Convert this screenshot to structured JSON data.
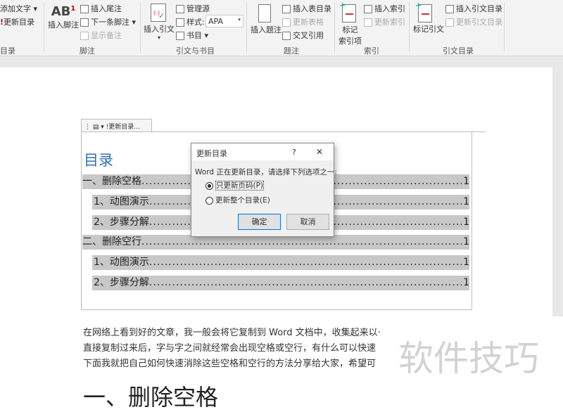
{
  "ribbon": {
    "toc_group": {
      "add_text": "添加文字 ▾",
      "update_toc": "更新目录",
      "label": "目录"
    },
    "footnotes": {
      "insert_footnote": "插入脚注",
      "insert_endnote": "插入尾注",
      "next_footnote": "下一条脚注 ▾",
      "show_notes": "显示备注",
      "label": "脚注"
    },
    "citations": {
      "insert_citation": "插入引文",
      "manage_sources": "管理源",
      "style_label": "样式:",
      "style_value": "APA",
      "bibliography": "书目 ▾",
      "label": "引文与书目"
    },
    "captions": {
      "insert_caption": "插入题注",
      "insert_table_of_figures": "插入表目录",
      "update_table": "更新表格",
      "cross_reference": "交叉引用",
      "label": "题注"
    },
    "index": {
      "mark_entry_1": "标记",
      "mark_entry_2": "索引项",
      "insert_index": "插入索引",
      "update_index": "更新索引",
      "label": "索引"
    },
    "toa": {
      "mark_citation": "标记引文",
      "insert_toa": "插入引文目录",
      "update_toa": "更新引文目录",
      "label": "引文目录"
    }
  },
  "toc": {
    "tab_label": "更新目录...",
    "heading": "目录",
    "entries": [
      {
        "text": "一、删除空格",
        "page": "1"
      },
      {
        "text": "1、动图演示",
        "page": "1"
      },
      {
        "text": "2、步骤分解",
        "page": "1"
      },
      {
        "text": "二、删除空行",
        "page": "1"
      },
      {
        "text": "1、动图演示",
        "page": "1"
      },
      {
        "text": "2、步骤分解",
        "page": "1"
      }
    ]
  },
  "dialog": {
    "title": "更新目录",
    "help": "?",
    "close": "✕",
    "message": "Word 正在更新目录，请选择下列选项之一:",
    "option1": "只更新页码(P)",
    "option2": "更新整个目录(E)",
    "ok": "确定",
    "cancel": "取消"
  },
  "body": {
    "lines": [
      "在网络上看到好的文章，我一般会将它复制到 Word 文档中，收集起来以·",
      "直接复制过来后，字与字之间就经常会出现空格或空行，有什么可以快速",
      "下面我就把自己如何快速消除这些空格和空行的方法分享给大家，希望可"
    ],
    "heading": "一、删除空格"
  },
  "watermark": "软件技巧"
}
